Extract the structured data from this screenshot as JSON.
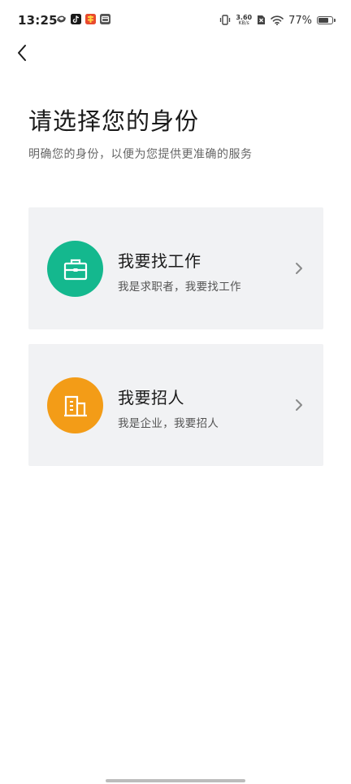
{
  "status_bar": {
    "time": "13:25",
    "net_speed_value": "3.60",
    "net_speed_unit": "KB/s",
    "battery_percent": "77%",
    "battery_level": 0.77
  },
  "header": {
    "back_icon": "chevron-left-icon"
  },
  "main": {
    "title": "请选择您的身份",
    "subtitle": "明确您的身份，以便为您提供更准确的服务"
  },
  "options": [
    {
      "title": "我要找工作",
      "description": "我是求职者，我要找工作",
      "icon": "briefcase-icon",
      "color": "#14b88e"
    },
    {
      "title": "我要招人",
      "description": "我是企业，我要招人",
      "icon": "building-icon",
      "color": "#f39c17"
    }
  ]
}
